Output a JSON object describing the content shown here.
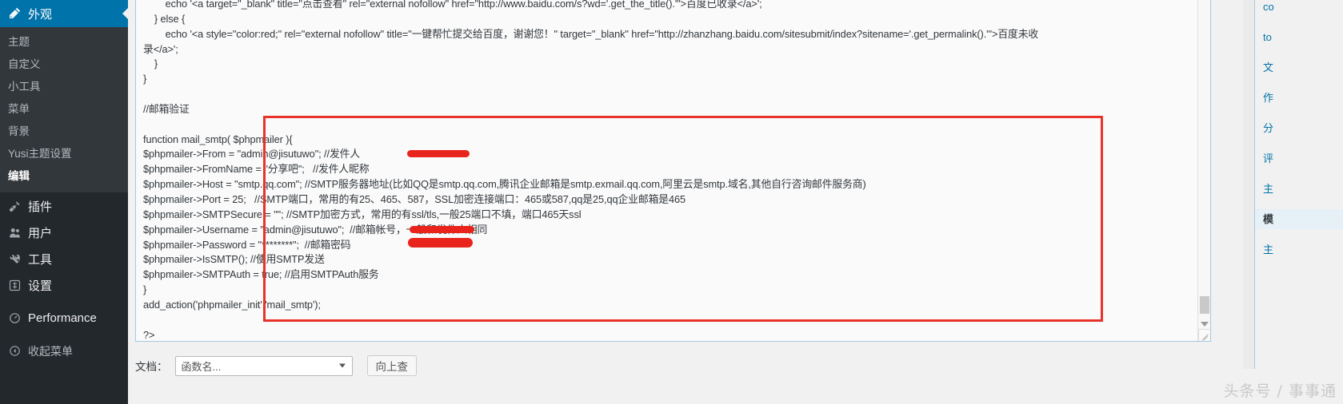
{
  "sidebar": {
    "current": {
      "label": "外观",
      "icon": "appearance-brush-icon",
      "accent_color": "#0073aa"
    },
    "submenu": [
      {
        "label": "主题",
        "current": false
      },
      {
        "label": "自定义",
        "current": false
      },
      {
        "label": "小工具",
        "current": false
      },
      {
        "label": "菜单",
        "current": false
      },
      {
        "label": "背景",
        "current": false
      },
      {
        "label": "Yusi主题设置",
        "current": false
      },
      {
        "label": "编辑",
        "current": true
      }
    ],
    "items": [
      {
        "label": "插件",
        "icon": "plugin-plug-icon"
      },
      {
        "label": "用户",
        "icon": "users-icon"
      },
      {
        "label": "工具",
        "icon": "tools-wrench-icon"
      },
      {
        "label": "设置",
        "icon": "settings-sliders-icon"
      }
    ],
    "extra_items": [
      {
        "label": "Performance",
        "icon": "performance-gauge-icon"
      }
    ],
    "collapse": {
      "label": "收起菜单",
      "icon": "collapse-arrow-icon"
    }
  },
  "editor": {
    "code_lines": [
      "        echo '<a target=\"_blank\" title=\"点击查看\" rel=\"external nofollow\" href=\"http://www.baidu.com/s?wd='.get_the_title().'\">百度已收录</a>';",
      "    } else {",
      "        echo '<a style=\"color:red;\" rel=\"external nofollow\" title=\"一键帮忙提交给百度，谢谢您！\" target=\"_blank\" href=\"http://zhanzhang.baidu.com/sitesubmit/index?sitename='.get_permalink().'\">百度未收",
      "录</a>';",
      "    }",
      "}",
      "",
      "//邮箱验证",
      "",
      "function mail_smtp( $phpmailer ){",
      "$phpmailer->From = \"admin@jisutuwo\"; //发件人",
      "$phpmailer->FromName = \"分享吧\";   //发件人昵称",
      "$phpmailer->Host = \"smtp.qq.com\"; //SMTP服务器地址(比如QQ是smtp.qq.com,腾讯企业邮箱是smtp.exmail.qq.com,阿里云是smtp.域名,其他自行咨询邮件服务商)",
      "$phpmailer->Port = 25;   //SMTP端口，常用的有25、465、587，SSL加密连接端口：465或587,qq是25,qq企业邮箱是465",
      "$phpmailer->SMTPSecure = \"\"; //SMTP加密方式，常用的有ssl/tls,一般25端口不填，端口465天ssl",
      "$phpmailer->Username = \"admin@jisutuwo\";  //邮箱帐号，一般和发件人相同",
      "$phpmailer->Password = \"********\";  //邮箱密码",
      "$phpmailer->IsSMTP(); //使用SMTP发送",
      "$phpmailer->SMTPAuth = true; //启用SMTPAuth服务",
      "}",
      "add_action('phpmailer_init','mail_smtp');",
      "",
      "?>"
    ],
    "annotation_box_color": "#e8332a",
    "redactions": [
      {
        "label": "from-email-redaction"
      },
      {
        "label": "username-email-redaction"
      },
      {
        "label": "password-redaction"
      }
    ]
  },
  "toolbar": {
    "doc_label": "文档：",
    "select_value": "函数名...",
    "lookup_button": "向上查"
  },
  "file_list": [
    {
      "label": "co",
      "current": false
    },
    {
      "label": "to",
      "current": false
    },
    {
      "label": "文",
      "current": false
    },
    {
      "label": "作",
      "current": false
    },
    {
      "label": "分",
      "current": false
    },
    {
      "label": "评",
      "current": false
    },
    {
      "label": "主",
      "current": false
    },
    {
      "label": "模",
      "current": true
    },
    {
      "label": "主",
      "current": false
    }
  ],
  "watermark": "头条号 / 事事通"
}
